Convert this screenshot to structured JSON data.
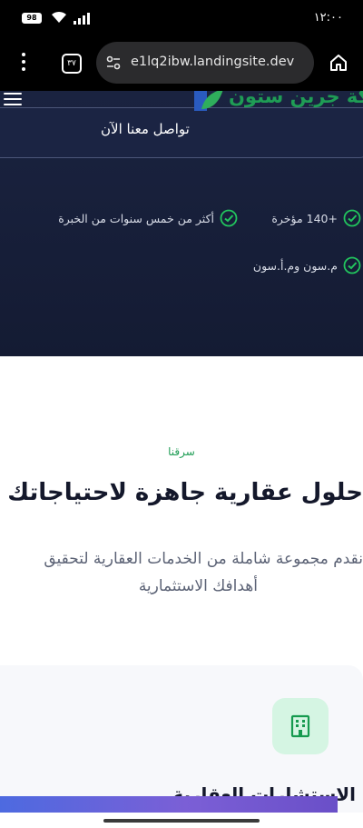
{
  "status_bar": {
    "time": "١٢:٠٠",
    "battery": "98"
  },
  "browser": {
    "tab_count": "٣٧",
    "url": "e1lq2ibw.landingsite.dev"
  },
  "hero": {
    "logo_text": "شركة جرين ستون",
    "card_text": "تواصل معنا الآن",
    "features": [
      {
        "text": "+140 مؤخرة"
      },
      {
        "text": "أكثر من خمس سنوات من الخبرة"
      },
      {
        "text": "م.سون وم.أ.سون"
      }
    ]
  },
  "section": {
    "tag": "سرقنا",
    "title": "حلول عقارية جاهزة لاحتياجاتك",
    "desc_line1": "نقدم مجموعة شاملة من الخدمات العقارية لتحقيق",
    "desc_line2": "أهدافك الاستثمارية"
  },
  "service": {
    "title": "الاستشارات العقارية"
  },
  "colors": {
    "accent": "#1f9d55",
    "hero_bg": "#1a2340",
    "icon_bg": "#d5f5e3"
  }
}
